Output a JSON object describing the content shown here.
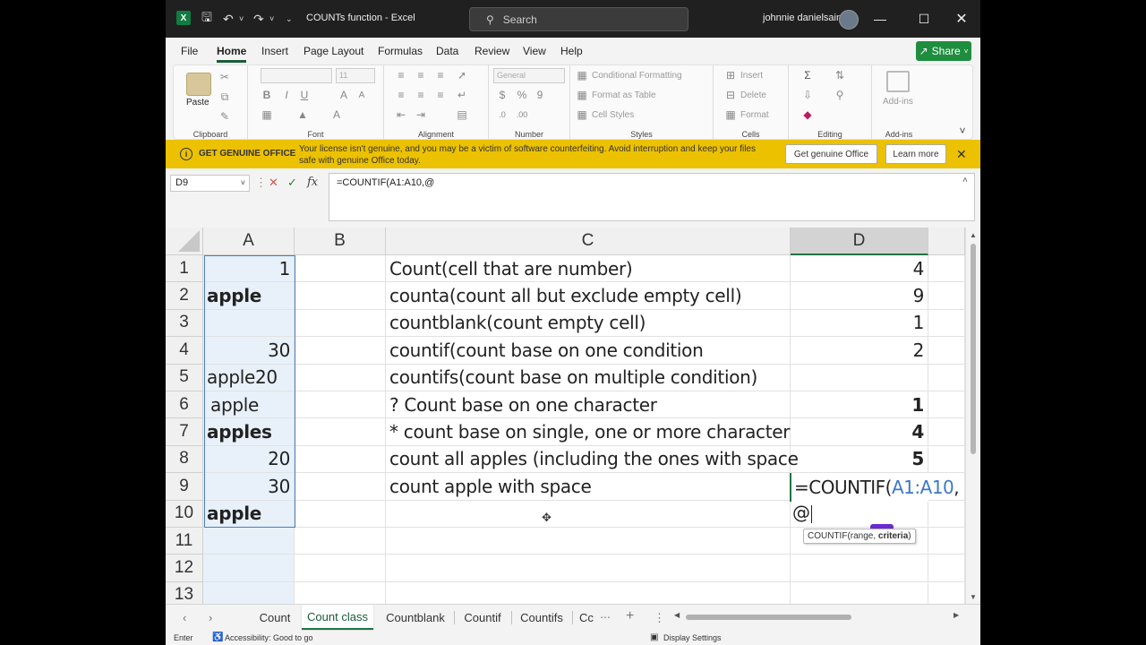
{
  "titlebar": {
    "title": "COUNTs function  -  Excel",
    "search_placeholder": "Search",
    "user_name": "johnnie danielsaint",
    "logo_letter": "X"
  },
  "menu": {
    "tabs": [
      "File",
      "Home",
      "Insert",
      "Page Layout",
      "Formulas",
      "Data",
      "Review",
      "View",
      "Help"
    ],
    "active": "Home",
    "share_label": "Share"
  },
  "ribbon": {
    "groups": {
      "clipboard": "Clipboard",
      "font": "Font",
      "alignment": "Alignment",
      "number": "Number",
      "styles": "Styles",
      "cells": "Cells",
      "editing": "Editing",
      "addins": "Add-ins"
    },
    "paste_label": "Paste",
    "font_size": "11",
    "number_format": "General",
    "conditional_formatting": "Conditional Formatting",
    "format_as_table": "Format as Table",
    "cell_styles": "Cell Styles",
    "insert": "Insert",
    "delete": "Delete",
    "format": "Format",
    "addins_label": "Add-ins"
  },
  "banner": {
    "title": "GET GENUINE OFFICE",
    "message": "Your license isn't genuine, and you may be a victim of software counterfeiting. Avoid interruption and keep your files safe with genuine Office today.",
    "get_button": "Get genuine Office",
    "learn_button": "Learn more",
    "color": "#ecc100"
  },
  "formula_bar": {
    "name_box": "D9",
    "formula": "=COUNTIF(A1:A10,@"
  },
  "grid": {
    "columns": [
      "A",
      "B",
      "C",
      "D"
    ],
    "selected_column": "D",
    "rows": [
      {
        "n": "1",
        "a": "1",
        "c": "Count(cell that are number)",
        "d": "4"
      },
      {
        "n": "2",
        "a": "apple",
        "c": "counta(count all but exclude empty cell)",
        "d": "9"
      },
      {
        "n": "3",
        "a": "",
        "c": "countblank(count empty cell)",
        "d": "1"
      },
      {
        "n": "4",
        "a": "30",
        "c": "countif(count base on one condition",
        "d": "2"
      },
      {
        "n": "5",
        "a": "apple20",
        "c": "countifs(count base on multiple condition)",
        "d": ""
      },
      {
        "n": "6",
        "a": " apple",
        "c": "? Count base on one character",
        "d": "1"
      },
      {
        "n": "7",
        "a": "apples",
        "c": "* count base on single, one or more character",
        "d": "4"
      },
      {
        "n": "8",
        "a": "20",
        "c": "count all apples (including the ones with space",
        "d": "5"
      },
      {
        "n": "9",
        "a": "30",
        "c": "count apple with space",
        "d": ""
      },
      {
        "n": "10",
        "a": "apple",
        "c": "",
        "d": ""
      },
      {
        "n": "11",
        "a": "",
        "c": "",
        "d": ""
      },
      {
        "n": "12",
        "a": "",
        "c": "",
        "d": ""
      },
      {
        "n": "13",
        "a": "",
        "c": "",
        "d": ""
      }
    ],
    "edit": {
      "prefix": "=COUNTIF(",
      "ref": "A1:A10",
      "suffix": ",",
      "line2": "@",
      "tooltip_fn": "COUNTIF(range, ",
      "tooltip_bold": "criteria",
      "tooltip_end": ")"
    }
  },
  "sheets": {
    "tabs": [
      "Count",
      "Count class",
      "Countblank",
      "Countif",
      "Countifs",
      "Cc"
    ],
    "active": "Count class"
  },
  "status": {
    "mode": "Enter",
    "accessibility": "Accessibility: Good to go",
    "display_settings": "Display Settings"
  }
}
